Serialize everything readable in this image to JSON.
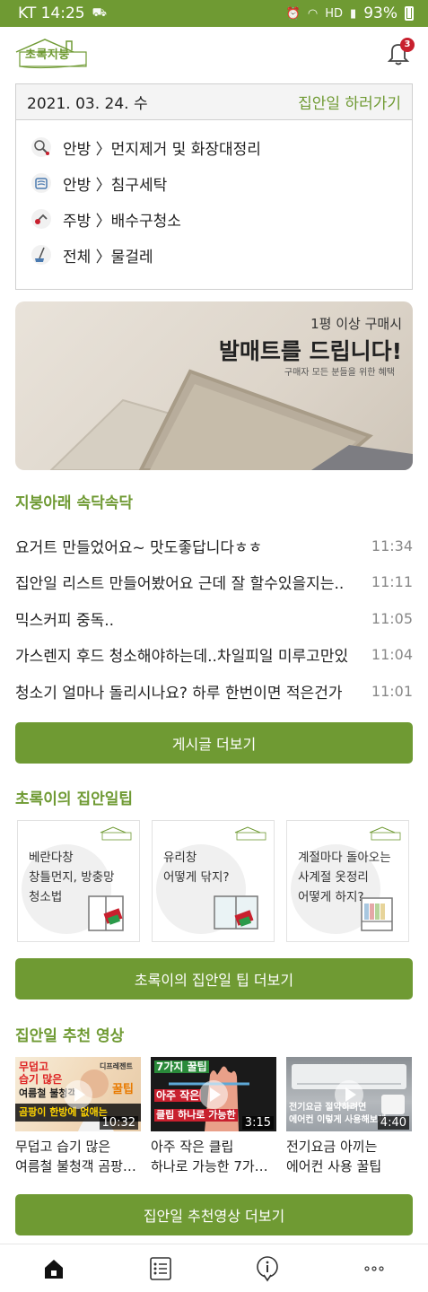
{
  "status_bar": {
    "carrier_time": "KT 14:25",
    "battery": "93%"
  },
  "app": {
    "logo_text": "초록지붕",
    "notification_count": "3"
  },
  "todo": {
    "date": "2021. 03. 24. 수",
    "link_label": "집안일 하러가기",
    "items": [
      {
        "label": "안방 〉먼지제거 및 화장대정리",
        "icon": "duster-icon"
      },
      {
        "label": "안방 〉침구세탁",
        "icon": "washing-icon"
      },
      {
        "label": "주방 〉배수구청소",
        "icon": "drain-icon"
      },
      {
        "label": "전체 〉물걸레",
        "icon": "mop-icon"
      }
    ]
  },
  "banner": {
    "subtitle": "1평 이상 구매시",
    "title": "발매트를 드립니다!",
    "note": "구매자 모든 분들을 위한 혜택"
  },
  "board": {
    "title": "지붕아래 속닥속닥",
    "posts": [
      {
        "title": "요거트 만들었어요~  맛도좋답니다ㅎㅎ",
        "time": "11:34"
      },
      {
        "title": "집안일 리스트 만들어봤어요 근데 잘 할수있을지는..",
        "time": "11:11"
      },
      {
        "title": "믹스커피 중독..",
        "time": "11:05"
      },
      {
        "title": "가스렌지 후드 청소해야하는데..차일피일 미루고만있",
        "time": "11:04"
      },
      {
        "title": "청소기 얼마나 돌리시나요?  하루 한번이면 적은건가",
        "time": "11:01"
      }
    ],
    "more_button": "게시글 더보기"
  },
  "tips": {
    "title": "초록이의 집안일팁",
    "cards": [
      {
        "text": "베란다창\n창틀먼지, 방충망\n청소법",
        "logo": "초록지붕"
      },
      {
        "text": "유리창\n어떻게 닦지?",
        "logo": "초록지붕"
      },
      {
        "text": "계절마다 돌아오는\n사계절 옷정리\n어떻게 하지?",
        "logo": "초록지붕"
      }
    ],
    "more_button": "초록이의 집안일 팁 더보기"
  },
  "videos": {
    "title": "집안일 추천 영상",
    "items": [
      {
        "title": "무덥고 습기 많은\n여름철 불청객 곰팡…",
        "duration": "10:32",
        "caption1": "무덥고",
        "caption2": "습기 많은",
        "caption3": "여름철 불청객",
        "caption4": "곰팡이 한방에 없애는",
        "caption5": "꿀팁",
        "caption6": "디프레젠트"
      },
      {
        "title": "아주 작은 클립\n하나로 가능한 7가…",
        "duration": "3:15",
        "caption1": "7가지 꿀팁",
        "caption2": "아주 작은",
        "caption3": "클립 하나로 가능한"
      },
      {
        "title": "전기요금 아끼는\n에어컨 사용 꿀팁",
        "duration": "4:40",
        "caption1": "전기요금 절약하려면",
        "caption2": "에어컨 이렇게 사용해보세"
      }
    ],
    "more_button": "집안일 추천영상 더보기"
  },
  "colors": {
    "brand_green": "#6f9a33",
    "badge_red": "#c8202e"
  },
  "nav": [
    "home-icon",
    "list-icon",
    "info-icon",
    "more-icon"
  ]
}
